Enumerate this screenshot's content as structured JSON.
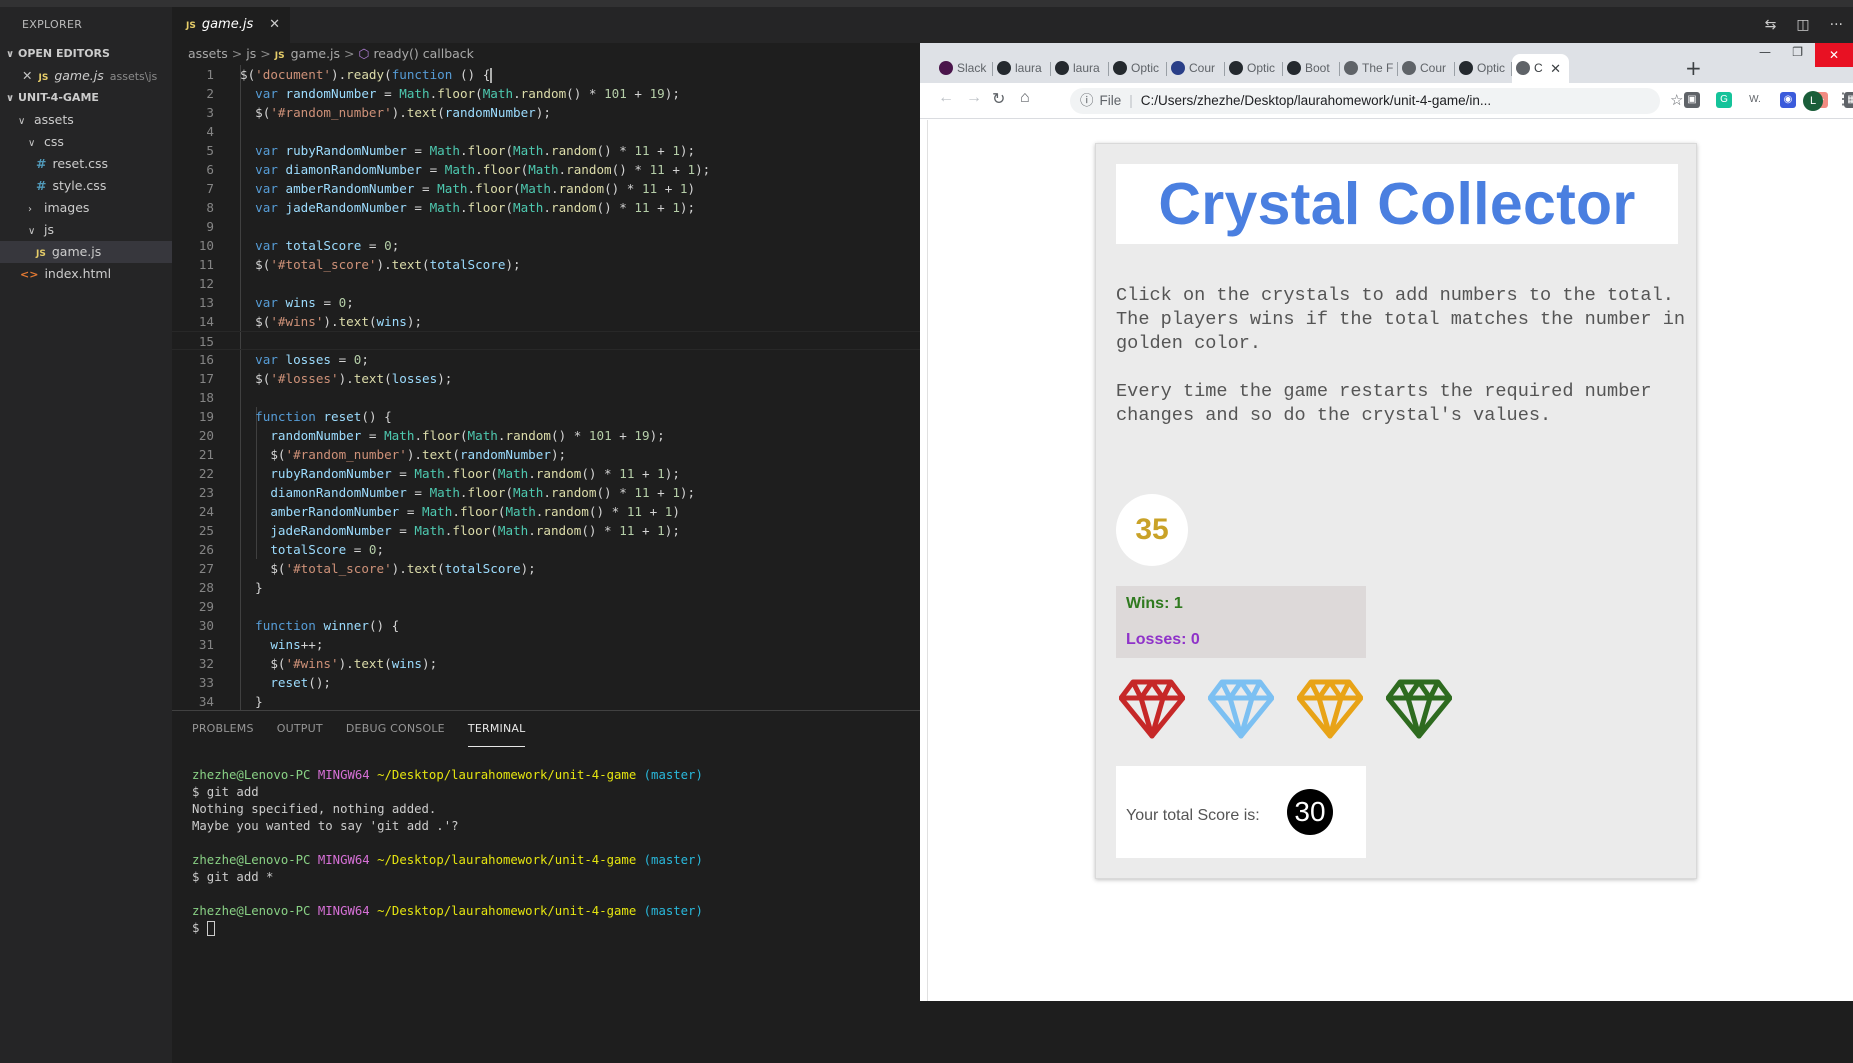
{
  "explorer": {
    "title": "EXPLORER",
    "open_editors_label": "OPEN EDITORS",
    "open_editor": {
      "name": "game.js",
      "path": "assets\\js",
      "badge": "JS"
    },
    "project_label": "UNIT-4-GAME",
    "tree": {
      "assets": "assets",
      "css": "css",
      "reset_css": "reset.css",
      "style_css": "style.css",
      "images": "images",
      "js": "js",
      "game_js": "game.js",
      "index_html": "index.html",
      "css_badge": "#",
      "html_badge": "<>",
      "js_badge": "JS"
    }
  },
  "editor": {
    "tab": {
      "label": "game.js",
      "badge": "JS",
      "close": "✕"
    },
    "breadcrumb": {
      "p1": "assets",
      "p2": "js",
      "p3": "game.js",
      "p4": "ready() callback",
      "sep": ">",
      "badge": "JS"
    },
    "lines": [
      {
        "n": "1",
        "text": "$('document').ready(function () {"
      },
      {
        "n": "2",
        "text": "  var randomNumber = Math.floor(Math.random() * 101 + 19);"
      },
      {
        "n": "3",
        "text": "  $('#random_number').text(randomNumber);"
      },
      {
        "n": "4",
        "text": ""
      },
      {
        "n": "5",
        "text": "  var rubyRandomNumber = Math.floor(Math.random() * 11 + 1);"
      },
      {
        "n": "6",
        "text": "  var diamonRandomNumber = Math.floor(Math.random() * 11 + 1);"
      },
      {
        "n": "7",
        "text": "  var amberRandomNumber = Math.floor(Math.random() * 11 + 1)"
      },
      {
        "n": "8",
        "text": "  var jadeRandomNumber = Math.floor(Math.random() * 11 + 1);"
      },
      {
        "n": "9",
        "text": ""
      },
      {
        "n": "10",
        "text": "  var totalScore = 0;"
      },
      {
        "n": "11",
        "text": "  $('#total_score').text(totalScore);"
      },
      {
        "n": "12",
        "text": ""
      },
      {
        "n": "13",
        "text": "  var wins = 0;"
      },
      {
        "n": "14",
        "text": "  $('#wins').text(wins);"
      },
      {
        "n": "15",
        "text": ""
      },
      {
        "n": "16",
        "text": "  var losses = 0;"
      },
      {
        "n": "17",
        "text": "  $('#losses').text(losses);"
      },
      {
        "n": "18",
        "text": ""
      },
      {
        "n": "19",
        "text": "  function reset() {"
      },
      {
        "n": "20",
        "text": "    randomNumber = Math.floor(Math.random() * 101 + 19);"
      },
      {
        "n": "21",
        "text": "    $('#random_number').text(randomNumber);"
      },
      {
        "n": "22",
        "text": "    rubyRandomNumber = Math.floor(Math.random() * 11 + 1);"
      },
      {
        "n": "23",
        "text": "    diamonRandomNumber = Math.floor(Math.random() * 11 + 1);"
      },
      {
        "n": "24",
        "text": "    amberRandomNumber = Math.floor(Math.random() * 11 + 1)"
      },
      {
        "n": "25",
        "text": "    jadeRandomNumber = Math.floor(Math.random() * 11 + 1);"
      },
      {
        "n": "26",
        "text": "    totalScore = 0;"
      },
      {
        "n": "27",
        "text": "    $('#total_score').text(totalScore);"
      },
      {
        "n": "28",
        "text": "  }"
      },
      {
        "n": "29",
        "text": ""
      },
      {
        "n": "30",
        "text": "  function winner() {"
      },
      {
        "n": "31",
        "text": "    wins++;"
      },
      {
        "n": "32",
        "text": "    $('#wins').text(wins);"
      },
      {
        "n": "33",
        "text": "    reset();"
      },
      {
        "n": "34",
        "text": "  }"
      }
    ]
  },
  "panel": {
    "tabs": [
      "PROBLEMS",
      "OUTPUT",
      "DEBUG CONSOLE",
      "TERMINAL"
    ],
    "terminal": {
      "user": "zhezhe@Lenovo-PC",
      "host": "MINGW64",
      "path": "~/Desktop/laurahomework/unit-4-game",
      "branch": "(master)",
      "cmd1": "$ git add",
      "out1": "Nothing specified, nothing added.",
      "out2": "Maybe you wanted to say 'git add .'?",
      "cmd2": "$ git add *",
      "prompt": "$ "
    }
  },
  "browser": {
    "tabs": [
      {
        "label": "Slack",
        "fav_color": "#4a154b"
      },
      {
        "label": "laura",
        "fav_color": "#24292e"
      },
      {
        "label": "laura",
        "fav_color": "#24292e"
      },
      {
        "label": "Optic",
        "fav_color": "#24292e"
      },
      {
        "label": "Cour",
        "fav_color": "#2a3f88"
      },
      {
        "label": "Optic",
        "fav_color": "#24292e"
      },
      {
        "label": "Boot",
        "fav_color": "#24292e"
      },
      {
        "label": "The F",
        "fav_color": "#5f6368"
      },
      {
        "label": "Cour",
        "fav_color": "#5f6368"
      },
      {
        "label": "Optic",
        "fav_color": "#24292e"
      },
      {
        "label": "C",
        "fav_color": "#5f6368"
      }
    ],
    "active_close": "✕",
    "new_tab": "+",
    "url_scheme": "File",
    "url": "C:/Users/zhezhe/Desktop/laurahomework/unit-4-game/in...",
    "avatar_letter": "L",
    "extensions": [
      {
        "label": "▣",
        "color": "#5f6368"
      },
      {
        "label": "G",
        "color": "#15c39a"
      },
      {
        "label": "W.",
        "color": "#ffffff"
      },
      {
        "label": "◉",
        "color": "#3b5bdb"
      },
      {
        "label": "◆",
        "color": "#f28b82"
      },
      {
        "label": "▦",
        "color": "#5f6368"
      },
      {
        "label": "▢",
        "color": "#dadce0"
      }
    ]
  },
  "game": {
    "title": "Crystal Collector",
    "desc1": "Click on the crystals to add numbers to the total. The players wins if the total matches the number in golden color.",
    "desc2": "Every time the game restarts the required number changes and so do the crystal's values.",
    "target": "35",
    "wins_label": "Wins: ",
    "wins": "1",
    "losses_label": "Losses: ",
    "losses": "0",
    "score_label": "Your total Score is:",
    "score": "30",
    "crystals": [
      {
        "name": "ruby",
        "color": "#c62828"
      },
      {
        "name": "diamond",
        "color": "#7cc0f2"
      },
      {
        "name": "amber",
        "color": "#e8a317"
      },
      {
        "name": "jade",
        "color": "#2e6b1f"
      }
    ]
  }
}
